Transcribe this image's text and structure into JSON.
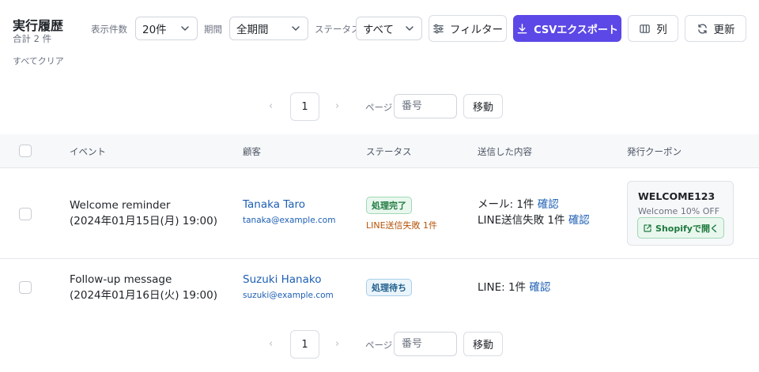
{
  "header": {
    "title": "実行履歴",
    "subtitle": "合計 2 件",
    "clear_all": "すべてクリア"
  },
  "toolbar": {
    "per_page_label": "表示件数",
    "per_page_value": "20件",
    "period_label": "期間",
    "period_value": "全期間",
    "status_label": "ステータス",
    "status_value": "すべて",
    "filter_label": "フィルター",
    "csv_label": "CSVエクスポート",
    "columns_label": "列",
    "refresh_label": "更新"
  },
  "pagination": {
    "current_page": "1",
    "page_label": "ページ",
    "page_placeholder": "番号",
    "go_label": "移動",
    "prev_glyph": "‹",
    "next_glyph": "›"
  },
  "table": {
    "columns": [
      "イベント",
      "顧客",
      "ステータス",
      "送信した内容",
      "発行クーポン"
    ],
    "rows": [
      {
        "event_line1": "Welcome reminder",
        "event_line2": "(2024年01月15日(月) 19:00)",
        "customer_name": "Tanaka Taro",
        "customer_email": "tanaka@example.com",
        "status": "処理完了",
        "status_note": "LINE送信失敗 1件",
        "sent_line1": "メール: 1件",
        "sent_line2": "LINE送信失敗 1件",
        "confirm": "確認",
        "coupon_code": "WELCOME123",
        "coupon_desc": "Welcome 10% OFF",
        "coupon_button": "Shopifyで開く"
      },
      {
        "event_line1": "Follow-up message",
        "event_line2": "(2024年01月16日(火) 19:00)",
        "customer_name": "Suzuki Hanako",
        "customer_email": "suzuki@example.com",
        "status": "処理待ち",
        "sent_line1": "LINE: 1件",
        "confirm": "確認"
      }
    ]
  },
  "colors": {
    "primary": "#5c48e6",
    "link": "#1e5fb4",
    "success": "#1f7a3f",
    "warning": "#b45309",
    "info": "#1f5e8c"
  }
}
